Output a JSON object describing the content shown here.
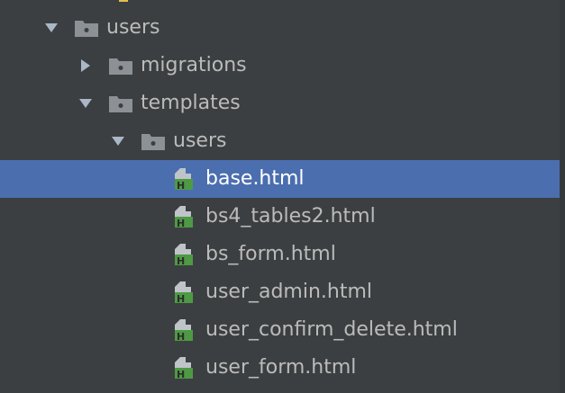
{
  "project_tree": {
    "items": [
      {
        "label": "",
        "icon": "python-file-icon",
        "expanded": null,
        "selected": false,
        "depth": 3,
        "partial": true
      },
      {
        "label": "users",
        "icon": "folder-icon",
        "expanded": true,
        "selected": false,
        "depth": 1
      },
      {
        "label": "migrations",
        "icon": "folder-icon",
        "expanded": false,
        "selected": false,
        "depth": 2
      },
      {
        "label": "templates",
        "icon": "folder-icon",
        "expanded": true,
        "selected": false,
        "depth": 2
      },
      {
        "label": "users",
        "icon": "folder-icon",
        "expanded": true,
        "selected": false,
        "depth": 3
      },
      {
        "label": "base.html",
        "icon": "html-file-icon",
        "expanded": null,
        "selected": true,
        "depth": 4
      },
      {
        "label": "bs4_tables2.html",
        "icon": "html-file-icon",
        "expanded": null,
        "selected": false,
        "depth": 4
      },
      {
        "label": "bs_form.html",
        "icon": "html-file-icon",
        "expanded": null,
        "selected": false,
        "depth": 4
      },
      {
        "label": "user_admin.html",
        "icon": "html-file-icon",
        "expanded": null,
        "selected": false,
        "depth": 4
      },
      {
        "label": "user_confirm_delete.html",
        "icon": "html-file-icon",
        "expanded": null,
        "selected": false,
        "depth": 4
      },
      {
        "label": "user_form.html",
        "icon": "html-file-icon",
        "expanded": null,
        "selected": false,
        "depth": 4
      }
    ]
  },
  "colors": {
    "background": "#3c3f41",
    "selection": "#4b6eaf",
    "text": "#bbbbbb",
    "folder": "#8c9196",
    "html_green": "#4e9a44"
  }
}
